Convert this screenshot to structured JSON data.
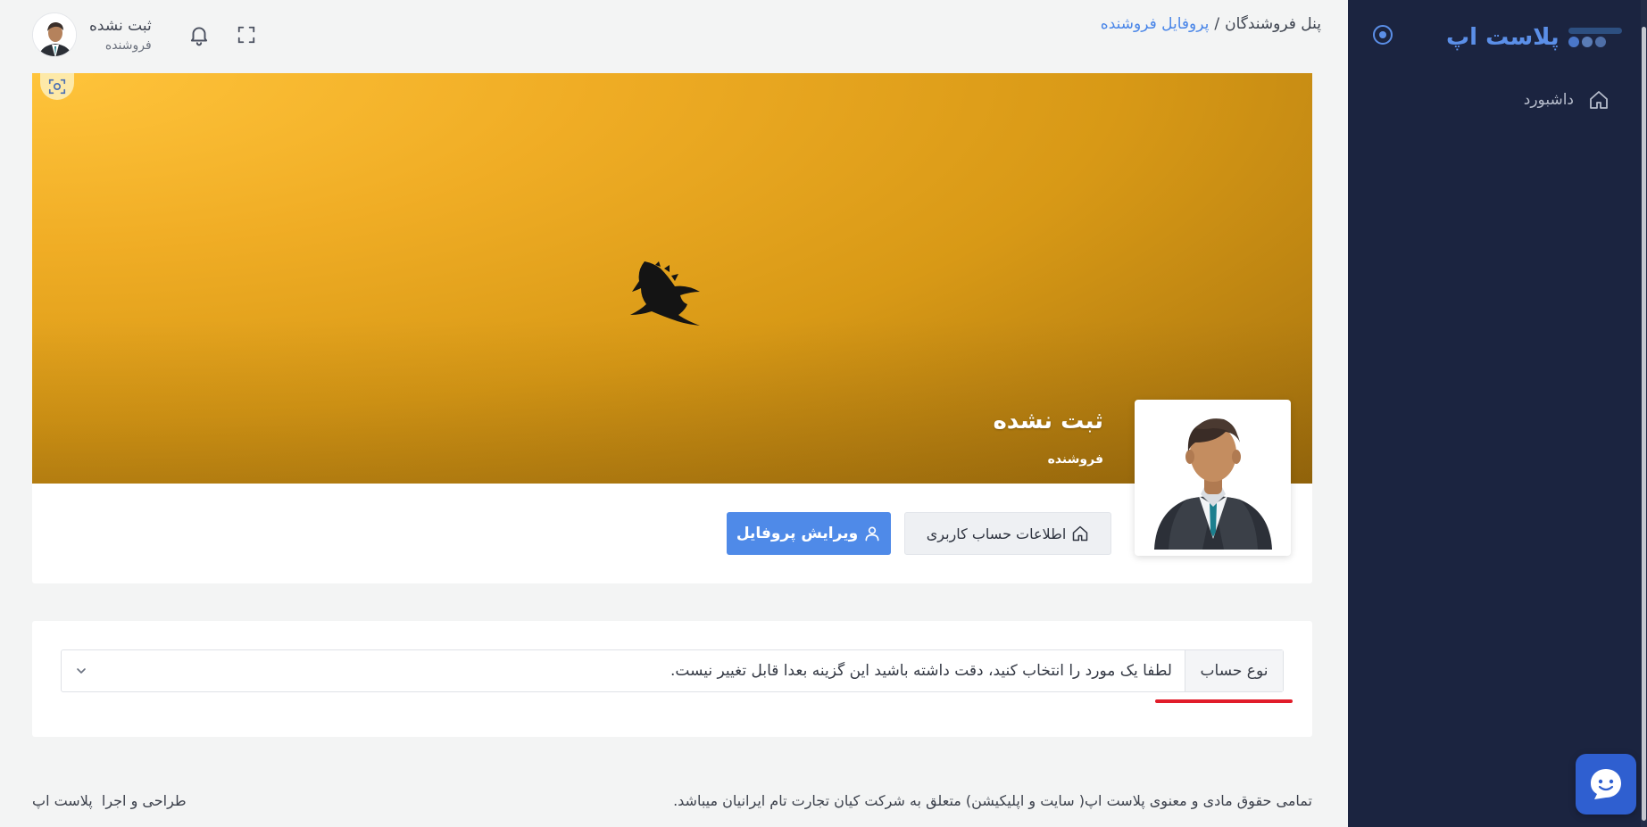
{
  "sidebar": {
    "brand_name": "پلاست اپ",
    "nav_items": [
      {
        "label": "داشبورد",
        "icon": "home-icon"
      }
    ]
  },
  "header": {
    "breadcrumb": {
      "root": "پنل فروشندگان",
      "separator": "/",
      "current": "پروفایل فروشنده"
    },
    "user": {
      "name": "ثبت نشده",
      "role": "فروشنده"
    }
  },
  "profile": {
    "name": "ثبت نشده",
    "role": "فروشنده",
    "account_info_button": "اطلاعات حساب کاربری",
    "edit_profile_button": "ویرایش پروفایل"
  },
  "account_type": {
    "label": "نوع حساب",
    "select_value": "لطفا یک مورد را انتخاب کنید، دقت داشته باشید این گزینه بعدا قابل تغییر نیست."
  },
  "footer": {
    "copyright": "تمامی حقوق مادی و معنوی پلاست اپ( سایت و اپلیکیشن) متعلق به شرکت کیان تجارت تام ایرانیان میباشد.",
    "credit_prefix": "طراحی و اجرا",
    "credit_name": "پلاست اپ"
  },
  "colors": {
    "sidebar_bg": "#1b2440",
    "accent": "#4f8ae8",
    "brand": "#5b8fe8",
    "cover_start": "#ffc43b",
    "cover_end": "#9e6d0d",
    "highlight_underline": "#e11d2a"
  }
}
